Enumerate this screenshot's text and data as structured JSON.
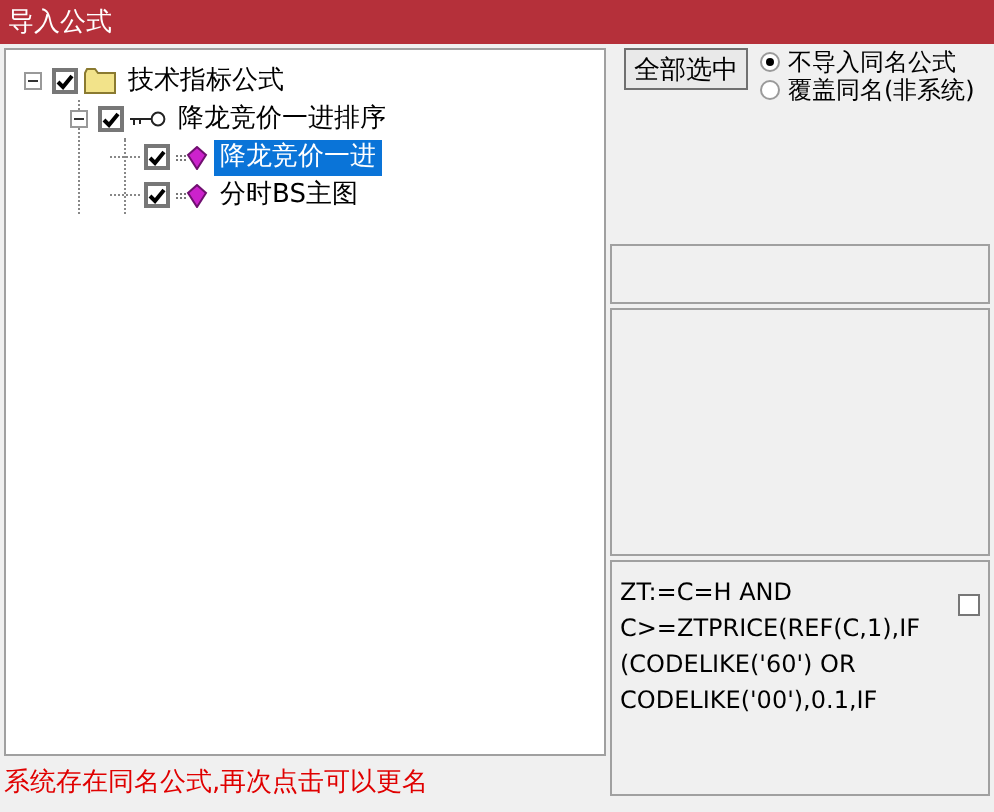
{
  "window": {
    "title": "导入公式"
  },
  "tree": [
    {
      "label": "技术指标公式",
      "kind": "folder",
      "expanded": true,
      "checked": true,
      "selected": false,
      "children": [
        {
          "label": "降龙竞价一进排序",
          "kind": "group",
          "expanded": true,
          "checked": true,
          "selected": false,
          "children": [
            {
              "label": "降龙竞价一进",
              "kind": "formula",
              "checked": true,
              "selected": true
            },
            {
              "label": "分时BS主图",
              "kind": "formula",
              "checked": true,
              "selected": false
            }
          ]
        }
      ]
    }
  ],
  "select_all_button": "全部选中",
  "import_options": [
    {
      "label": "不导入同名公式",
      "selected": true
    },
    {
      "label": "覆盖同名(非系统)",
      "selected": false
    }
  ],
  "formula_preview": {
    "lines": [
      "ZT:=C=H AND",
      "C>=ZTPRICE(REF(C,1),IF",
      "(CODELIKE('60') OR",
      "CODELIKE('00'),0.1,IF"
    ],
    "checkbox": {
      "checked": false
    }
  },
  "status_message": "系统存在同名公式,再次点击可以更名"
}
